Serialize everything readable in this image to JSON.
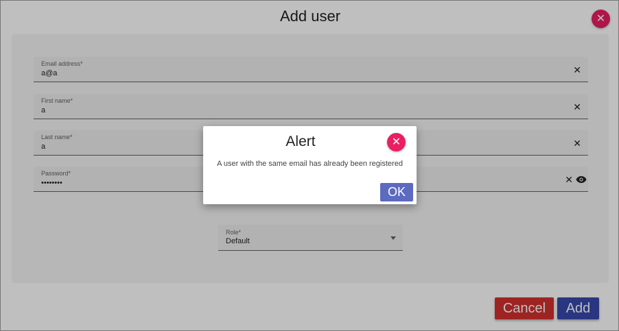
{
  "dialog": {
    "title": "Add user",
    "close_icon": "close-icon"
  },
  "form": {
    "email": {
      "label": "Email address*",
      "value": "a@a"
    },
    "first_name": {
      "label": "First name*",
      "value": "a"
    },
    "last_name": {
      "label": "Last name*",
      "value": "a"
    },
    "password": {
      "label": "Password*",
      "value": "••••••••"
    },
    "role": {
      "label": "Role*",
      "value": "Default"
    },
    "clear_glyph": "✕"
  },
  "actions": {
    "cancel_label": "Cancel",
    "add_label": "Add"
  },
  "alert": {
    "title": "Alert",
    "message": "A user with the same email has already been registered",
    "ok_label": "OK",
    "close_glyph": "✕"
  },
  "colors": {
    "close_button": "#e91e63",
    "cancel": "#d32f2f",
    "add": "#3949ab",
    "ok": "#5c6bc0"
  }
}
